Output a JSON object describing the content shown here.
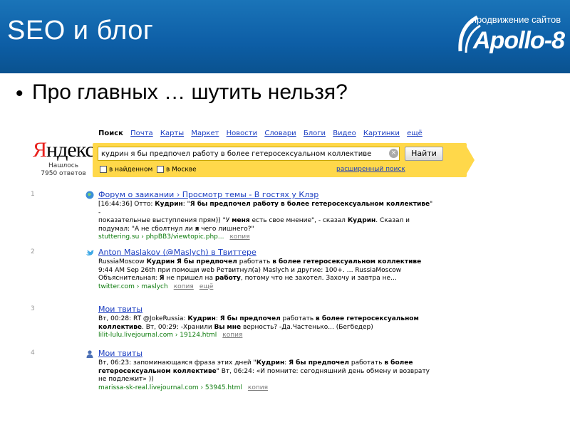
{
  "slide": {
    "title": "SEO и блог",
    "bullet": "•",
    "subtitle": "Про главных … шутить нельзя?"
  },
  "logo": {
    "tagline": "продвижение сайтов",
    "name": "Apollo-8"
  },
  "colors": {
    "header_blue": "#0d5ea6",
    "yandex_red": "#e8201c",
    "search_yellow": "#ffd84a",
    "link_blue": "#1a3dc1",
    "url_green": "#0a7a0a"
  },
  "serp": {
    "nav": {
      "active": "Поиск",
      "items": [
        "Почта",
        "Карты",
        "Маркет",
        "Новости",
        "Словари",
        "Блоги",
        "Видео",
        "Картинки",
        "ещё"
      ]
    },
    "logo": {
      "first": "Я",
      "rest": "ндекс"
    },
    "found": {
      "line1": "Нашлось",
      "line2": "7950 ответов"
    },
    "query": "кудрин я бы предпочел работу в более гетеросексуальном коллективе",
    "clear_icon": "×",
    "find_button": "Найти",
    "option_found": "в найденном",
    "option_moscow": "в Москве",
    "advanced": "расширенный поиск",
    "results": [
      {
        "num": "1",
        "icon": "globe-icon",
        "title": "Форум о заикании › Просмотр темы - В гостях у Клэр",
        "line1_pre": "[16:44:36] Отто: ",
        "line1_b1": "Кудрин",
        "line1_mid": ": \"",
        "line1_b2": "Я бы предпочел работу в более гетеросексуальном коллективе",
        "line1_post": "\" -",
        "line2_pre": "показательные выступления прям)) \"У ",
        "line2_b1": "меня",
        "line2_mid": " есть свое мнение\", - сказал ",
        "line2_b2": "Кудрин",
        "line2_post": ". Сказал и",
        "line3_pre": "подумал: \"А не сболтнул ли ",
        "line3_b1": "я",
        "line3_post": " чего лишнего?\"",
        "url": "stuttering.su › phpBB3/viewtopic.php...",
        "copy": "копия"
      },
      {
        "num": "2",
        "icon": "twitter-bird-icon",
        "title": "Anton Maslakov (@Maslych) в Твиттере",
        "line1_pre": "RussiaMoscow ",
        "line1_b1": "Кудрин",
        "line1_b2": "Я бы предпочел",
        "line1_mid": " работать ",
        "line1_b3": "в более гетеросексуальном коллективе",
        "line2": "9:44 AM Sep 26th при помощи web Ретвитнул(а) Maslych и другие: 100+. … RussiaMoscow",
        "line3_pre": "Объяснительная: ",
        "line3_b1": "Я",
        "line3_mid": " не пришел на ",
        "line3_b2": "работу",
        "line3_post": ", потому что не захотел. Захочу и завтра не…",
        "url": "twitter.com › maslych",
        "copy": "копия",
        "more": "ещё"
      },
      {
        "num": "3",
        "title": "Мои твиты",
        "line1_pre": "Вт, 00:28: RT @JokeRussia: ",
        "line1_b1": "Кудрин",
        "line1_mid": ": ",
        "line1_b2": "Я бы предпочел",
        "line1_mid2": " работать ",
        "line1_b3": "в более гетеросексуальном",
        "line2_b1": "коллективе",
        "line2_mid": ". Вт, 00:29: -Хранили ",
        "line2_b2": "Вы",
        "line2_mid2": " ",
        "line2_b3": "мне",
        "line2_post": " верность? -Да.Частенько... (Бегбедер)",
        "url": "lilit-lulu.livejournal.com › 19124.html",
        "copy": "копия"
      },
      {
        "num": "4",
        "icon": "user-icon",
        "title": "Мои твиты",
        "line1_pre": "Вт, 06:23: запоминающаяся фраза этих дней \"",
        "line1_b1": "Кудрин",
        "line1_mid": ": ",
        "line1_b2": "Я бы предпочел",
        "line1_mid2": " работать ",
        "line1_b3": "в более",
        "line2_b1": "гетеросексуальном коллективе",
        "line2_post": "\" Вт, 06:24: «И помните: сегодняшний день обмену и возврату",
        "line3": "не подлежит» ))",
        "url": "marissa-sk-real.livejournal.com › 53945.html",
        "copy": "копия"
      }
    ]
  }
}
